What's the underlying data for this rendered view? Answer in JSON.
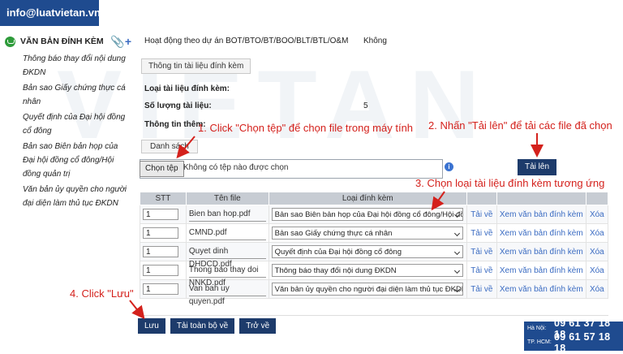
{
  "brand": "info@luatvietan.vn",
  "watermark": "VIETAN",
  "sidebar": {
    "title": "VĂN BẢN ĐÍNH KÈM",
    "items": [
      "Thông báo thay đổi nội dung ĐKDN",
      "Bản sao Giấy chứng thực cá nhân",
      "Quyết định của Đại hội đồng cổ đông",
      "Bản sao Biên bản họp của Đại hội đồng cổ đông/Hội đồng quản trị",
      "Văn bản ủy quyền cho người đại diện làm thủ tục ĐKDN"
    ]
  },
  "form": {
    "project_label": "Hoạt động theo dự án BOT/BTO/BT/BOO/BLT/BTL/O&M",
    "project_value": "Không",
    "tab_info": "Thông tin tài liệu đính kèm",
    "type_label": "Loại tài liệu đính kèm:",
    "count_label": "Số lượng tài liệu:",
    "count_value": "5",
    "more_label": "Thông tin thêm:",
    "tab_list": "Danh sách",
    "choose_button": "Chọn tệp",
    "file_status": "Không có tệp nào được chọn",
    "upload_button": "Tải lên"
  },
  "table": {
    "headers": [
      "STT",
      "Tên file",
      "Loại đính kèm"
    ],
    "rows": [
      {
        "stt": "1",
        "file": "Bien ban hop.pdf",
        "type": "Bản sao Biên bản họp của Đại hội đồng cổ đông/Hội đồng q"
      },
      {
        "stt": "1",
        "file": "CMND.pdf",
        "type": "Bản sao Giấy chứng thực cá nhân"
      },
      {
        "stt": "1",
        "file": "Quyet dinh DHDCD.pdf",
        "type": "Quyết định của Đại hội đồng cổ đông"
      },
      {
        "stt": "1",
        "file": "Thong bao thay doi NNKD.pdf",
        "type": "Thông báo thay đổi nội dung ĐKDN"
      },
      {
        "stt": "1",
        "file": "Van ban uy quyen.pdf",
        "type": "Văn bản ủy quyền cho người đại diện làm thủ tục ĐKDN"
      }
    ],
    "action_download": "Tải về",
    "action_view": "Xem văn bản đính kèm",
    "action_delete": "Xóa"
  },
  "buttons": {
    "save": "Lưu",
    "download_all": "Tải toàn bộ về",
    "back": "Trở về"
  },
  "annotations": {
    "step1": "1. Click \"Chọn tệp\" để chọn file trong máy tính",
    "step2": "2. Nhấn \"Tải lên\" để tải các file đã chọn",
    "step3": "3. Chọn loại tài liệu đính kèm tương ứng",
    "step4": "4. Click \"Lưu\""
  },
  "hotline": {
    "hn_label": "Hà Nội:",
    "hn_number": "09 61 37 18 18",
    "hcm_label": "TP. HCM:",
    "hcm_number": "09 61 57 18 18"
  },
  "colors": {
    "navy": "#1d3b6b",
    "brand_blue": "#1f4b8f",
    "annotation_red": "#d4211c",
    "link_blue": "#3a6bc2"
  }
}
